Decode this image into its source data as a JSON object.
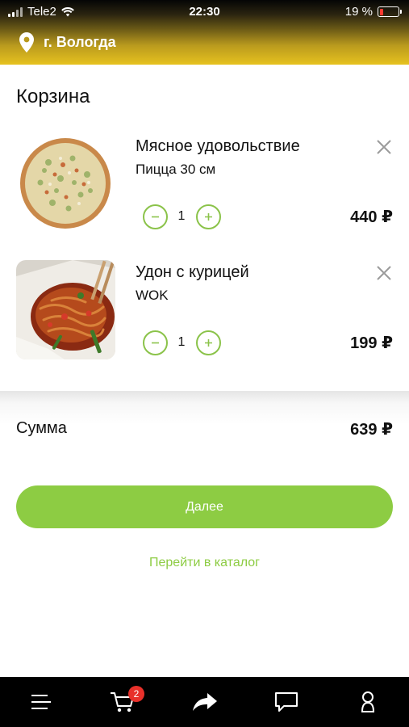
{
  "status_bar": {
    "carrier": "Tele2",
    "time": "22:30",
    "battery_percent": "19 %",
    "battery_level": 0.19
  },
  "location": {
    "city": "г. Вологда",
    "icon": "location-pin-icon"
  },
  "cart": {
    "title": "Корзина",
    "items": [
      {
        "name": "Мясное удовольствие",
        "variant": "Пицца 30 см",
        "quantity": "1",
        "price": "440 ₽",
        "image": "pizza-image"
      },
      {
        "name": "Удон с курицей",
        "variant": "WOK",
        "quantity": "1",
        "price": "199 ₽",
        "image": "udon-wok-image"
      }
    ],
    "total_label": "Сумма",
    "total_value": "639 ₽",
    "next_label": "Далее",
    "catalog_link": "Перейти в каталог"
  },
  "tab_bar": {
    "cart_badge": "2",
    "tabs": [
      "menu-icon",
      "cart-icon",
      "share-icon",
      "chat-icon",
      "profile-icon"
    ]
  },
  "colors": {
    "accent_green": "#8dcc43",
    "header_gold": "#e7c21f",
    "badge_red": "#e8302a",
    "tab_bar": "#000000"
  }
}
